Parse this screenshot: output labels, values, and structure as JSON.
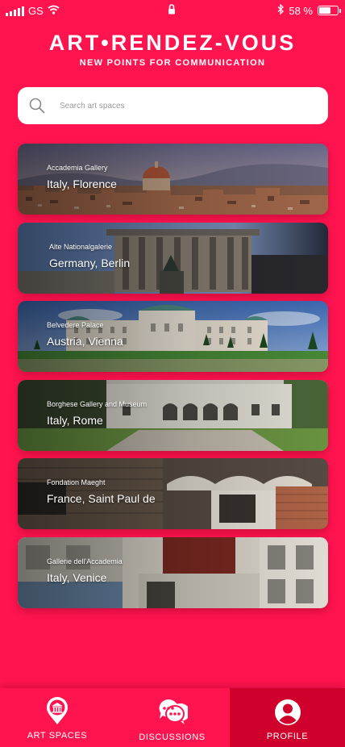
{
  "status_bar": {
    "carrier": "GS",
    "battery_text": "58 %",
    "battery_level": 0.58,
    "icons": [
      "signal-icon",
      "wifi-icon",
      "lock-icon",
      "bluetooth-icon",
      "battery-icon"
    ]
  },
  "header": {
    "title": "ART•RENDEZ-VOUS",
    "subtitle": "NEW POINTS FOR COMMUNICATION"
  },
  "search": {
    "placeholder": "Search art spaces",
    "value": "",
    "icon": "search-icon"
  },
  "cards": [
    {
      "museum": "Accademia Gallery",
      "location": "Italy, Florence",
      "theme": "florence"
    },
    {
      "museum": "Alte Nationalgalerie",
      "location": "Germany, Berlin",
      "theme": "berlin"
    },
    {
      "museum": "Belvedere Palace",
      "location": "Austria, Vienna",
      "theme": "vienna"
    },
    {
      "museum": "Borghese Gallery and Museum",
      "location": "Italy, Rome",
      "theme": "rome"
    },
    {
      "museum": "Fondation Maeght",
      "location": "France, Saint Paul de",
      "theme": "maeght"
    },
    {
      "museum": "Gallerie dell'Accademia",
      "location": "Italy, Venice",
      "theme": "venice"
    }
  ],
  "bottom_nav": {
    "items": [
      {
        "label": "ART SPACES",
        "icon": "museum-pin-icon",
        "active": false
      },
      {
        "label": "DISCUSSIONS",
        "icon": "chat-bubbles-icon",
        "active": false
      },
      {
        "label": "PROFILE",
        "icon": "user-profile-icon",
        "active": true
      }
    ]
  },
  "colors": {
    "background": "#ff1450",
    "active_tab": "#d0002c",
    "search_bg": "#ffffff"
  }
}
